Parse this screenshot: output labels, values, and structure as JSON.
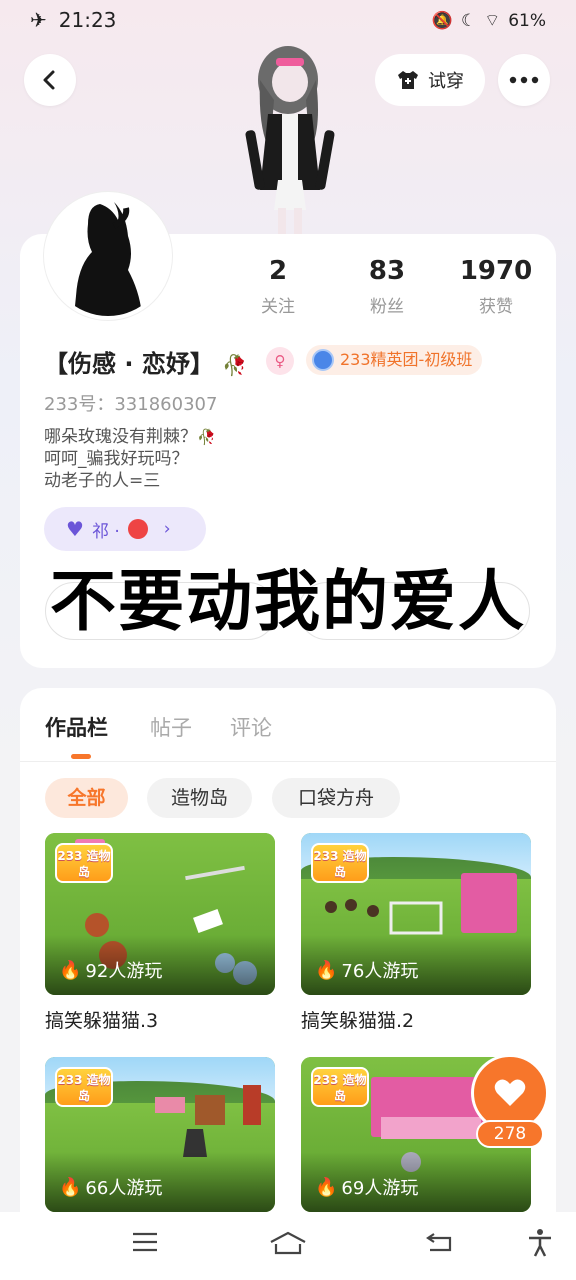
{
  "status_bar": {
    "time": "21:23",
    "battery": "61%"
  },
  "header": {
    "tryon_label": "试穿"
  },
  "profile": {
    "stats": [
      {
        "num": "2",
        "label": "关注"
      },
      {
        "num": "83",
        "label": "粉丝"
      },
      {
        "num": "1970",
        "label": "获赞"
      }
    ],
    "nickname": "【伤感 · 恋妤】",
    "level_badge": "233精英团-初级班",
    "uid": "233号：331860307",
    "bio_lines": [
      "哪朵玫瑰没有荆棘？",
      "呵呵_骗我好玩吗？",
      "动老子的人=三"
    ],
    "relation_chip": "祁 ·",
    "overlay_caption": "不要动我的爱人"
  },
  "works": {
    "tabs": [
      "作品栏",
      "帖子",
      "评论"
    ],
    "filters": [
      "全部",
      "造物岛",
      "口袋方舟"
    ],
    "games": [
      {
        "logo": "233 造物岛",
        "plays": "92人游玩",
        "title": "搞笑躲猫猫.3"
      },
      {
        "logo": "233 造物岛",
        "plays": "76人游玩",
        "title": "搞笑躲猫猫.2"
      },
      {
        "logo": "233 造物岛",
        "plays": "66人游玩",
        "title": ""
      },
      {
        "logo": "233 造物岛",
        "plays": "69人游玩",
        "title": ""
      }
    ]
  },
  "like_float": {
    "count": "278"
  },
  "colors": {
    "accent": "#f7762b",
    "purple": "#6b55d8",
    "pink": "#ea5a84"
  }
}
